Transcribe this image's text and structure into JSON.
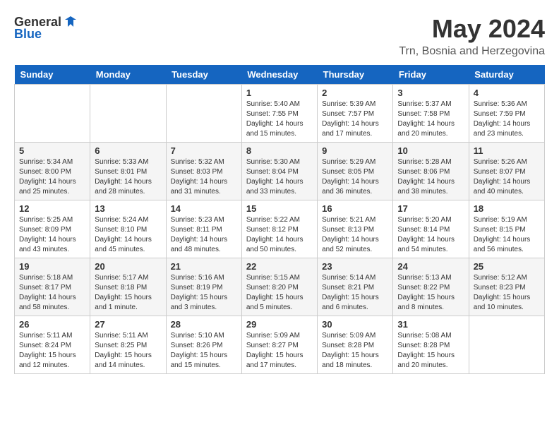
{
  "header": {
    "logo": {
      "general": "General",
      "blue": "Blue"
    },
    "title": "May 2024",
    "location": "Trn, Bosnia and Herzegovina"
  },
  "calendar": {
    "days_of_week": [
      "Sunday",
      "Monday",
      "Tuesday",
      "Wednesday",
      "Thursday",
      "Friday",
      "Saturday"
    ],
    "weeks": [
      [
        {
          "day": "",
          "info": ""
        },
        {
          "day": "",
          "info": ""
        },
        {
          "day": "",
          "info": ""
        },
        {
          "day": "1",
          "info": "Sunrise: 5:40 AM\nSunset: 7:55 PM\nDaylight: 14 hours\nand 15 minutes."
        },
        {
          "day": "2",
          "info": "Sunrise: 5:39 AM\nSunset: 7:57 PM\nDaylight: 14 hours\nand 17 minutes."
        },
        {
          "day": "3",
          "info": "Sunrise: 5:37 AM\nSunset: 7:58 PM\nDaylight: 14 hours\nand 20 minutes."
        },
        {
          "day": "4",
          "info": "Sunrise: 5:36 AM\nSunset: 7:59 PM\nDaylight: 14 hours\nand 23 minutes."
        }
      ],
      [
        {
          "day": "5",
          "info": "Sunrise: 5:34 AM\nSunset: 8:00 PM\nDaylight: 14 hours\nand 25 minutes."
        },
        {
          "day": "6",
          "info": "Sunrise: 5:33 AM\nSunset: 8:01 PM\nDaylight: 14 hours\nand 28 minutes."
        },
        {
          "day": "7",
          "info": "Sunrise: 5:32 AM\nSunset: 8:03 PM\nDaylight: 14 hours\nand 31 minutes."
        },
        {
          "day": "8",
          "info": "Sunrise: 5:30 AM\nSunset: 8:04 PM\nDaylight: 14 hours\nand 33 minutes."
        },
        {
          "day": "9",
          "info": "Sunrise: 5:29 AM\nSunset: 8:05 PM\nDaylight: 14 hours\nand 36 minutes."
        },
        {
          "day": "10",
          "info": "Sunrise: 5:28 AM\nSunset: 8:06 PM\nDaylight: 14 hours\nand 38 minutes."
        },
        {
          "day": "11",
          "info": "Sunrise: 5:26 AM\nSunset: 8:07 PM\nDaylight: 14 hours\nand 40 minutes."
        }
      ],
      [
        {
          "day": "12",
          "info": "Sunrise: 5:25 AM\nSunset: 8:09 PM\nDaylight: 14 hours\nand 43 minutes."
        },
        {
          "day": "13",
          "info": "Sunrise: 5:24 AM\nSunset: 8:10 PM\nDaylight: 14 hours\nand 45 minutes."
        },
        {
          "day": "14",
          "info": "Sunrise: 5:23 AM\nSunset: 8:11 PM\nDaylight: 14 hours\nand 48 minutes."
        },
        {
          "day": "15",
          "info": "Sunrise: 5:22 AM\nSunset: 8:12 PM\nDaylight: 14 hours\nand 50 minutes."
        },
        {
          "day": "16",
          "info": "Sunrise: 5:21 AM\nSunset: 8:13 PM\nDaylight: 14 hours\nand 52 minutes."
        },
        {
          "day": "17",
          "info": "Sunrise: 5:20 AM\nSunset: 8:14 PM\nDaylight: 14 hours\nand 54 minutes."
        },
        {
          "day": "18",
          "info": "Sunrise: 5:19 AM\nSunset: 8:15 PM\nDaylight: 14 hours\nand 56 minutes."
        }
      ],
      [
        {
          "day": "19",
          "info": "Sunrise: 5:18 AM\nSunset: 8:17 PM\nDaylight: 14 hours\nand 58 minutes."
        },
        {
          "day": "20",
          "info": "Sunrise: 5:17 AM\nSunset: 8:18 PM\nDaylight: 15 hours\nand 1 minute."
        },
        {
          "day": "21",
          "info": "Sunrise: 5:16 AM\nSunset: 8:19 PM\nDaylight: 15 hours\nand 3 minutes."
        },
        {
          "day": "22",
          "info": "Sunrise: 5:15 AM\nSunset: 8:20 PM\nDaylight: 15 hours\nand 5 minutes."
        },
        {
          "day": "23",
          "info": "Sunrise: 5:14 AM\nSunset: 8:21 PM\nDaylight: 15 hours\nand 6 minutes."
        },
        {
          "day": "24",
          "info": "Sunrise: 5:13 AM\nSunset: 8:22 PM\nDaylight: 15 hours\nand 8 minutes."
        },
        {
          "day": "25",
          "info": "Sunrise: 5:12 AM\nSunset: 8:23 PM\nDaylight: 15 hours\nand 10 minutes."
        }
      ],
      [
        {
          "day": "26",
          "info": "Sunrise: 5:11 AM\nSunset: 8:24 PM\nDaylight: 15 hours\nand 12 minutes."
        },
        {
          "day": "27",
          "info": "Sunrise: 5:11 AM\nSunset: 8:25 PM\nDaylight: 15 hours\nand 14 minutes."
        },
        {
          "day": "28",
          "info": "Sunrise: 5:10 AM\nSunset: 8:26 PM\nDaylight: 15 hours\nand 15 minutes."
        },
        {
          "day": "29",
          "info": "Sunrise: 5:09 AM\nSunset: 8:27 PM\nDaylight: 15 hours\nand 17 minutes."
        },
        {
          "day": "30",
          "info": "Sunrise: 5:09 AM\nSunset: 8:28 PM\nDaylight: 15 hours\nand 18 minutes."
        },
        {
          "day": "31",
          "info": "Sunrise: 5:08 AM\nSunset: 8:28 PM\nDaylight: 15 hours\nand 20 minutes."
        },
        {
          "day": "",
          "info": ""
        }
      ]
    ]
  }
}
